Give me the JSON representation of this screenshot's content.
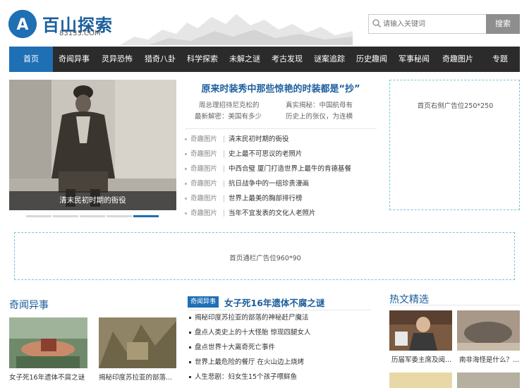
{
  "header": {
    "logo_text": "百山探索",
    "logo_sub": "83133.COM",
    "logo_mark": "A",
    "search_placeholder": "请输入关键词",
    "search_button": "搜索"
  },
  "nav": {
    "items": [
      "首页",
      "奇闻异事",
      "灵异恐怖",
      "猎奇八卦",
      "科学探索",
      "未解之谜",
      "考古发现",
      "谜案追踪",
      "历史趣闻",
      "军事秘闻",
      "奇趣图片",
      "专题"
    ],
    "active_index": 0
  },
  "slider": {
    "caption": "清末民初时期的衙役",
    "dot_count": 5,
    "active_dot": 4
  },
  "headline": {
    "title": "原来时装秀中那些惊艳的时装都是“抄”",
    "sub_left_1": "周总理招待尼克松的",
    "sub_right_1": "真实揭秘：中国航母有",
    "sub_left_2": "最新解密：美国有多少",
    "sub_right_2": "历史上的张仪，为连横"
  },
  "news": [
    {
      "cat": "奇趣图片",
      "title": "清末民初时期的衙役"
    },
    {
      "cat": "奇趣图片",
      "title": "史上最不可思议的老照片"
    },
    {
      "cat": "奇趣图片",
      "title": "中西合璧 厦门打造世界上最牛的肯德基餐"
    },
    {
      "cat": "奇趣图片",
      "title": "抗日战争中的一组珍贵漫画"
    },
    {
      "cat": "奇趣图片",
      "title": "世界上最美的胸部排行榜"
    },
    {
      "cat": "奇趣图片",
      "title": "当年不宜发表的文化人老照片"
    }
  ],
  "ads": {
    "right": "首页右侧广告位250*250",
    "wide": "首页通栏广告位960*90"
  },
  "section_left": {
    "title": "奇闻异事",
    "items": [
      {
        "caption": "女子死16年遗体不腐之谜"
      },
      {
        "caption": "揭秘印度苏拉亚的部落..."
      }
    ]
  },
  "section_mid": {
    "tag": "奇闻异事",
    "title": "女子死16年遗体不腐之谜",
    "items": [
      "揭秘印度苏拉亚的部落的神秘赶尸魔法",
      "盘点人类史上的十大怪胎 惊现四腿女人",
      "盘点世界十大离奇死亡事件",
      "世界上最危险的餐厅 在火山边上烧烤",
      "人生悲剧：妇女生15个孩子喂鲜鱼"
    ]
  },
  "section_right": {
    "title": "热文精选",
    "items": [
      {
        "caption": "历届军委主席及阅..."
      },
      {
        "caption": "南非海怪是什么？..."
      }
    ]
  }
}
